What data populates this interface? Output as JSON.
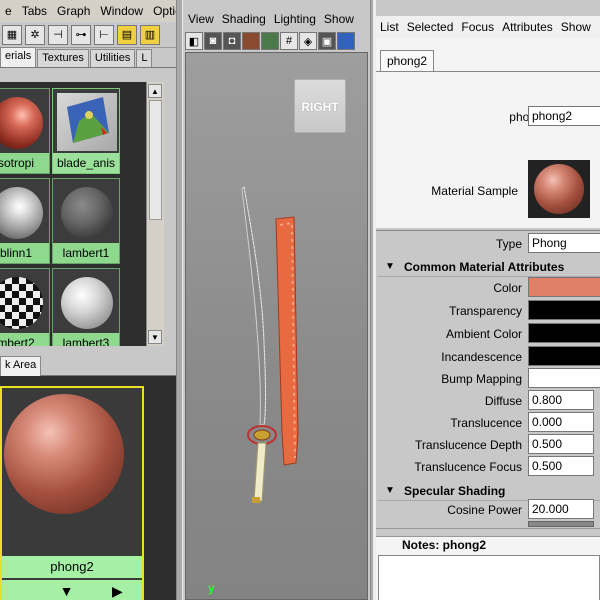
{
  "hypershade": {
    "menu": [
      "e",
      "Tabs",
      "Graph",
      "Window",
      "Optic"
    ],
    "tabs": [
      "erials",
      "Textures",
      "Utilities",
      "L"
    ],
    "swatches": [
      {
        "label": "sotropi"
      },
      {
        "label": "blade_anis"
      },
      {
        "label": "blinn1"
      },
      {
        "label": "lambert1"
      },
      {
        "label": "mbert2"
      },
      {
        "label": "lambert3"
      }
    ],
    "work_tab": "k Area",
    "work_node_label": "phong2"
  },
  "viewport": {
    "menu": [
      "View",
      "Shading",
      "Lighting",
      "Show"
    ],
    "viewcube_label": "RIGHT",
    "axis_label": "y"
  },
  "attribute_editor": {
    "menu": [
      "List",
      "Selected",
      "Focus",
      "Attributes",
      "Show"
    ],
    "tab": "phong2",
    "node_label": "phong:",
    "node_value": "phong2",
    "material_sample_label": "Material Sample",
    "type_label": "Type",
    "type_value": "Phong",
    "sections": {
      "common": "Common Material Attributes",
      "specular": "Specular Shading"
    },
    "attrs": {
      "color": "Color",
      "transparency": "Transparency",
      "ambient": "Ambient Color",
      "incandescence": "Incandescence",
      "bump": "Bump Mapping",
      "diffuse": "Diffuse",
      "diffuse_value": "0.800",
      "translucence": "Translucence",
      "translucence_value": "0.000",
      "translucence_depth": "Translucence Depth",
      "translucence_depth_value": "0.500",
      "translucence_focus": "Translucence Focus",
      "translucence_focus_value": "0.500",
      "cosine_power": "Cosine Power",
      "cosine_power_value": "20.000"
    },
    "colors": {
      "color": "#e08068",
      "transparency": "#000000",
      "ambient": "#000000",
      "incandescence": "#000000"
    },
    "notes_label": "Notes:  phong2"
  }
}
